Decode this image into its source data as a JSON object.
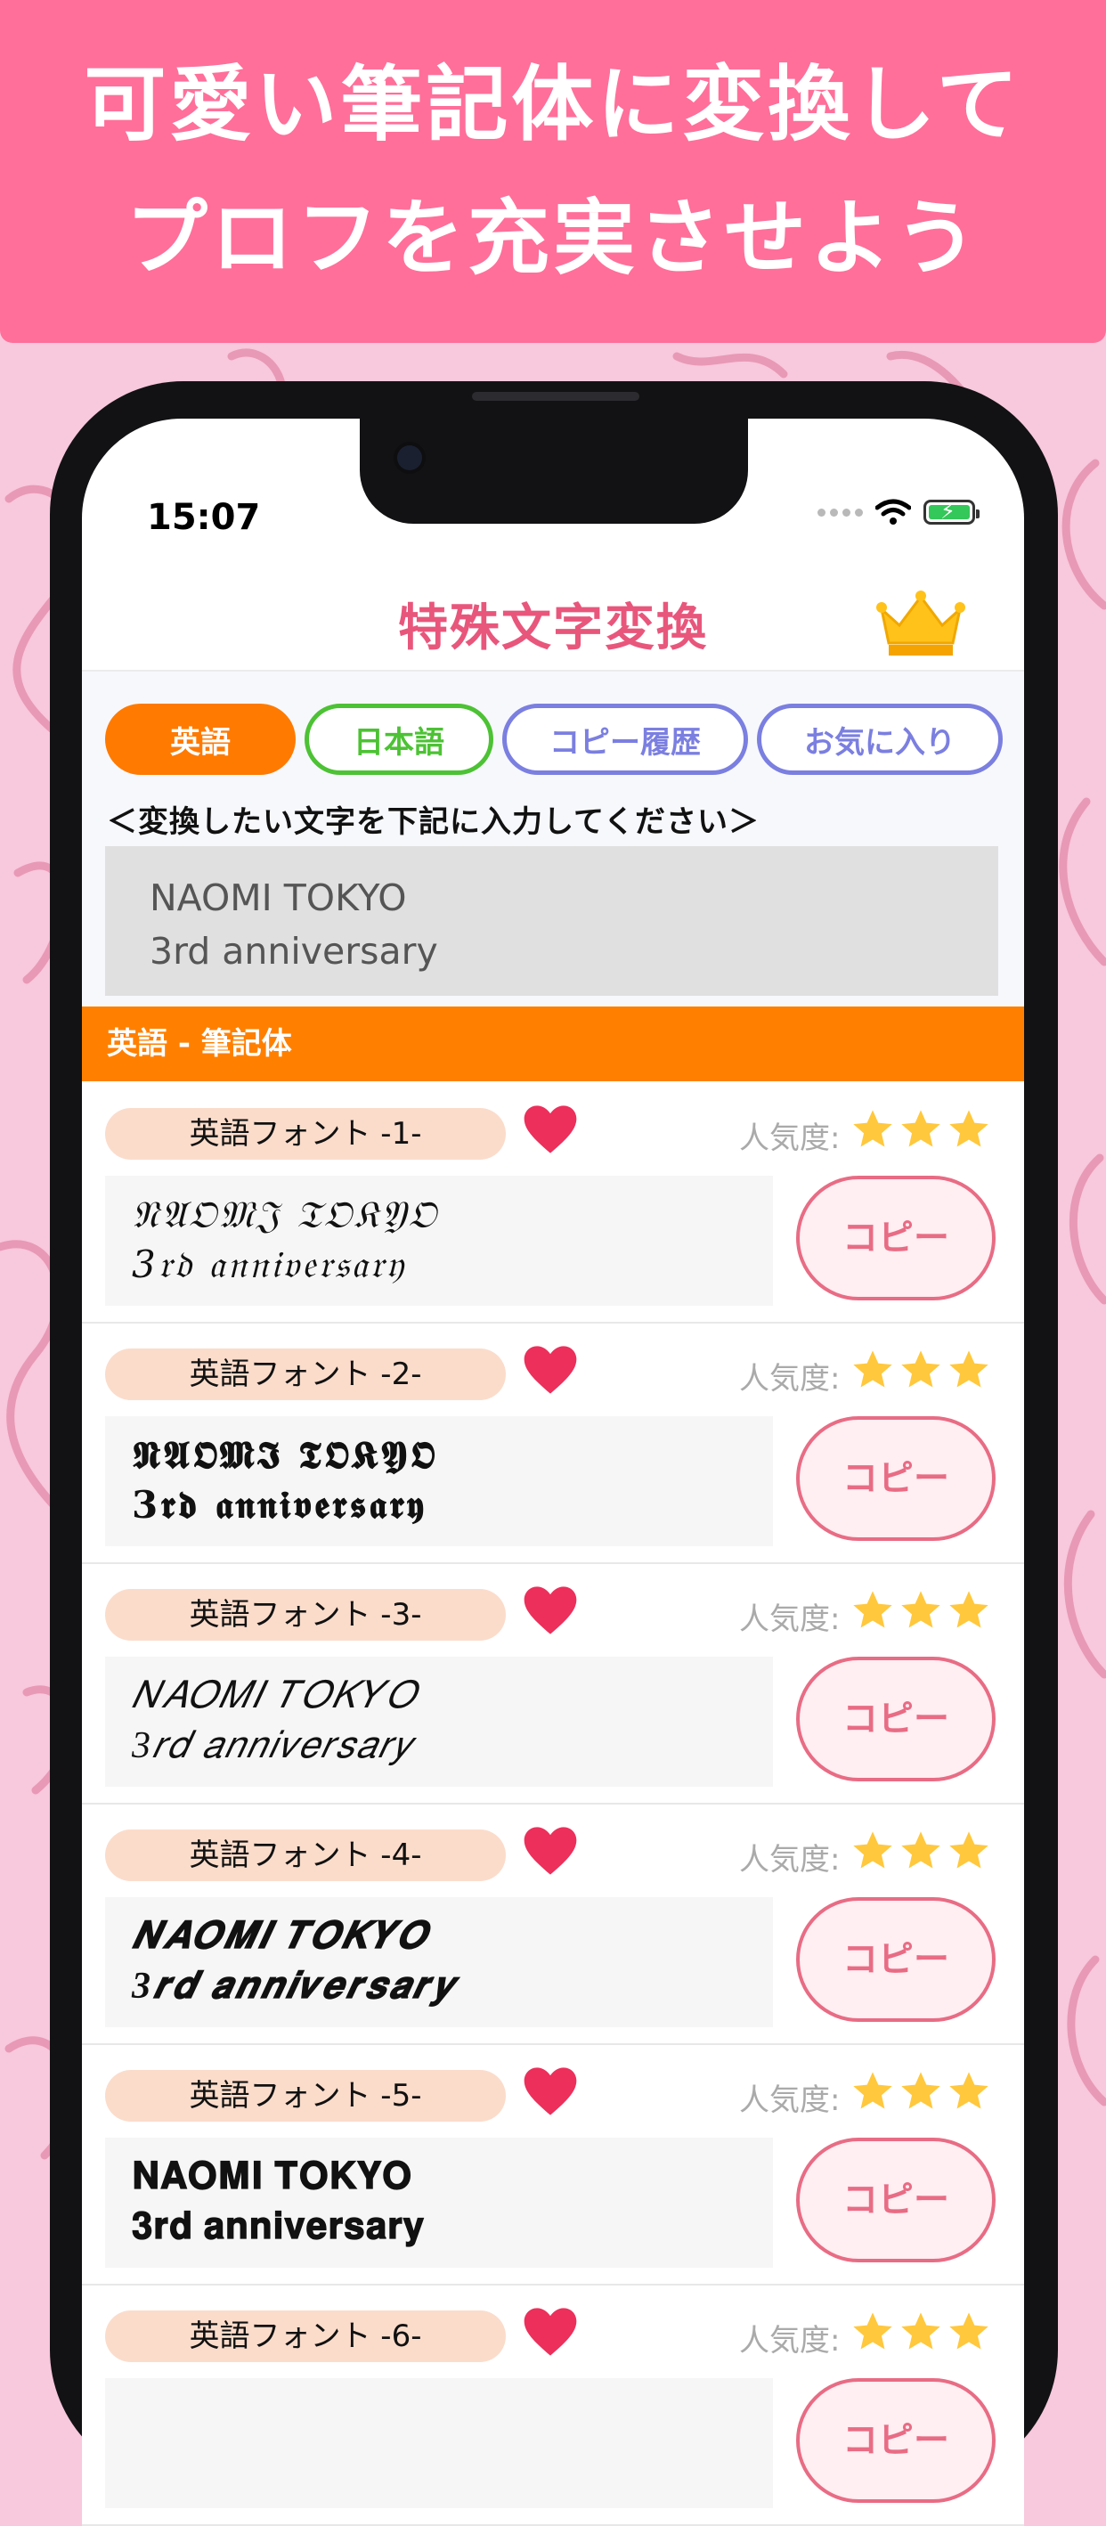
{
  "banner": {
    "line1": "可愛い筆記体に変換して",
    "line2": "プロフを充実させよう"
  },
  "status_bar": {
    "time": "15:07"
  },
  "app": {
    "title": "特殊文字変換",
    "crown_icon": "crown-icon",
    "tabs": [
      {
        "label": "英語",
        "selected": true,
        "color": "#ff7a00"
      },
      {
        "label": "日本語",
        "selected": false,
        "color": "#4cc234"
      },
      {
        "label": "コピー履歴",
        "selected": false,
        "color": "#7b7fe0"
      },
      {
        "label": "お気に入り",
        "selected": false,
        "color": "#7b7fe0"
      }
    ],
    "instruction": "＜変換したい文字を下記に入力してください＞",
    "input": {
      "line1": "NAOMI TOKYO",
      "line2": "3rd anniversary"
    },
    "section_header": "英語 - 筆記体",
    "popularity_label": "人気度:",
    "copy_label": "コピー",
    "fonts": [
      {
        "name": "英語フォント -1-",
        "line1": "𝔑𝔄𝔒𝔐𝔍 𝔗𝔒𝔎𝔜𝔒",
        "line2": "3𝔯𝔡 𝔞𝔫𝔫𝔦𝔳𝔢𝔯𝔰𝔞𝔯𝔶",
        "stars": 3
      },
      {
        "name": "英語フォント -2-",
        "line1": "𝕹𝕬𝕺𝕸𝕴 𝕿𝕺𝕶𝖄𝕺",
        "line2": "3𝖗𝖉 𝖆𝖓𝖓𝖎𝖛𝖊𝖗𝖘𝖆𝖗𝖞",
        "stars": 3
      },
      {
        "name": "英語フォント -3-",
        "line1": "𝑁𝐴𝑂𝑀𝐼 𝑇𝑂𝐾𝑌𝑂",
        "line2": "3𝑟𝑑 𝑎𝑛𝑛𝑖𝑣𝑒𝑟𝑠𝑎𝑟𝑦",
        "stars": 3
      },
      {
        "name": "英語フォント -4-",
        "line1": "𝑵𝑨𝑶𝑴𝑰 𝑻𝑶𝑲𝒀𝑶",
        "line2": "3𝒓𝒅 𝒂𝒏𝒏𝒊𝒗𝒆𝒓𝒔𝒂𝒓𝒚",
        "stars": 3
      },
      {
        "name": "英語フォント -5-",
        "line1": "𝐍𝐀𝐎𝐌𝐈 𝐓𝐎𝐊𝐘𝐎",
        "line2": "𝟑𝐫𝐝 𝐚𝐧𝐧𝐢𝐯𝐞𝐫𝐬𝐚𝐫𝐲",
        "stars": 3
      },
      {
        "name": "英語フォント -6-",
        "line1": "",
        "line2": "",
        "stars": 3
      }
    ]
  }
}
